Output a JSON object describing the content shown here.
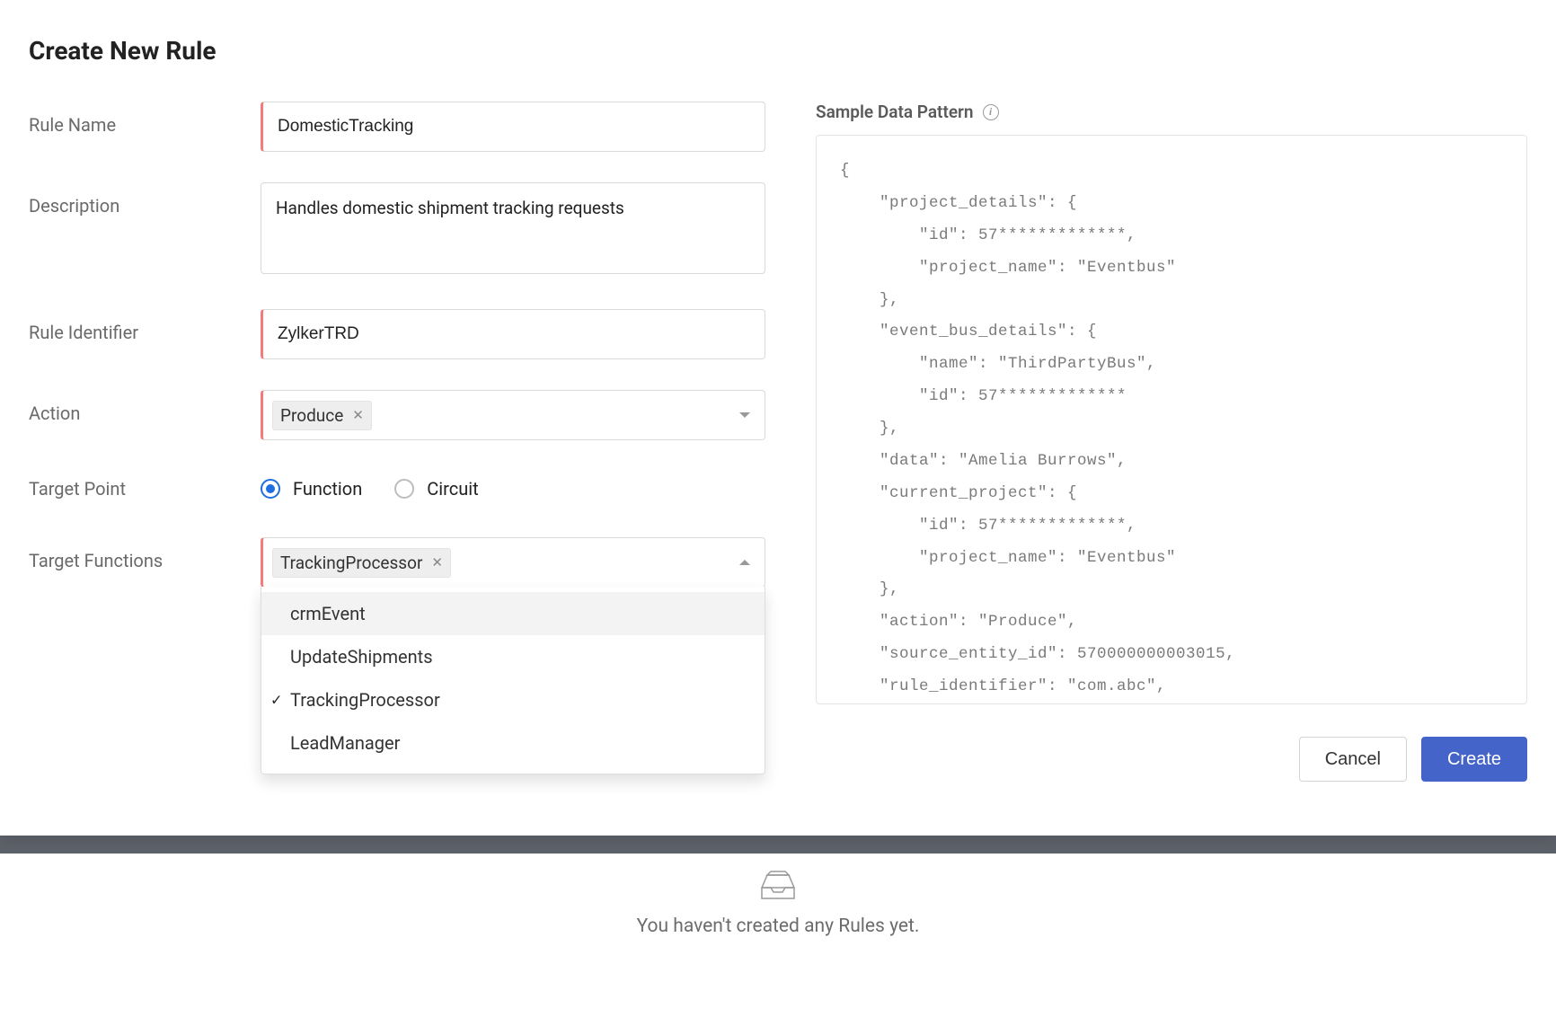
{
  "title": "Create New Rule",
  "form": {
    "ruleName": {
      "label": "Rule Name",
      "value": "DomesticTracking"
    },
    "description": {
      "label": "Description",
      "value": "Handles domestic shipment tracking requests"
    },
    "ruleIdentifier": {
      "label": "Rule Identifier",
      "value": "ZylkerTRD"
    },
    "action": {
      "label": "Action",
      "chip": "Produce"
    },
    "targetPoint": {
      "label": "Target Point",
      "options": [
        {
          "label": "Function",
          "selected": true
        },
        {
          "label": "Circuit",
          "selected": false
        }
      ]
    },
    "targetFunctions": {
      "label": "Target Functions",
      "chip": "TrackingProcessor",
      "menu": [
        {
          "label": "crmEvent",
          "selected": false,
          "hover": true
        },
        {
          "label": "UpdateShipments",
          "selected": false,
          "hover": false
        },
        {
          "label": "TrackingProcessor",
          "selected": true,
          "hover": false
        },
        {
          "label": "LeadManager",
          "selected": false,
          "hover": false
        }
      ]
    }
  },
  "sample": {
    "title": "Sample Data Pattern",
    "code": "{\n    \"project_details\": {\n        \"id\": 57*************,\n        \"project_name\": \"Eventbus\"\n    },\n    \"event_bus_details\": {\n        \"name\": \"ThirdPartyBus\",\n        \"id\": 57*************\n    },\n    \"data\": \"Amelia Burrows\",\n    \"current_project\": {\n        \"id\": 57*************,\n        \"project_name\": \"Eventbus\"\n    },\n    \"action\": \"Produce\",\n    \"source_entity_id\": 570000000003015,\n    \"rule_identifier\": \"com.abc\","
  },
  "buttons": {
    "cancel": "Cancel",
    "create": "Create"
  },
  "empty": {
    "text": "You haven't created any Rules yet."
  }
}
